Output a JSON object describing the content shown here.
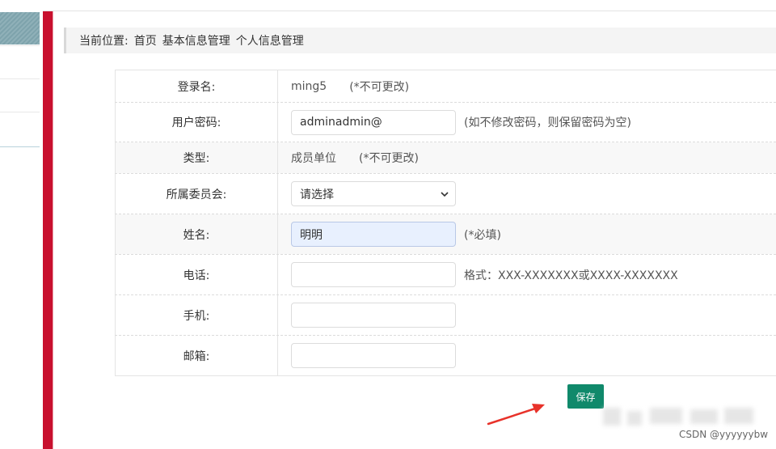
{
  "breadcrumb": {
    "prefix": "当前位置:",
    "items": [
      "首页",
      "基本信息管理",
      "个人信息管理"
    ]
  },
  "form": {
    "login": {
      "label": "登录名:",
      "value": "ming5",
      "note": "(*不可更改)"
    },
    "password": {
      "label": "用户密码:",
      "value": "adminadmin@",
      "note": "(如不修改密码，则保留密码为空)"
    },
    "type": {
      "label": "类型:",
      "value": "成员单位",
      "note": "(*不可更改)"
    },
    "committee": {
      "label": "所属委员会:",
      "selected": "请选择"
    },
    "name": {
      "label": "姓名:",
      "value": "明明",
      "note": "(*必填)"
    },
    "phone": {
      "label": "电话:",
      "value": "",
      "note": "格式：XXX-XXXXXXX或XXXX-XXXXXXX"
    },
    "mobile": {
      "label": "手机:",
      "value": ""
    },
    "email": {
      "label": "邮箱:",
      "value": ""
    }
  },
  "actions": {
    "save_label": "保存"
  },
  "watermark": "CSDN @yyyyyybw",
  "colors": {
    "accent_red": "#c8102e",
    "button_green": "#10896b",
    "autofill_blue": "#e8f0fe"
  }
}
